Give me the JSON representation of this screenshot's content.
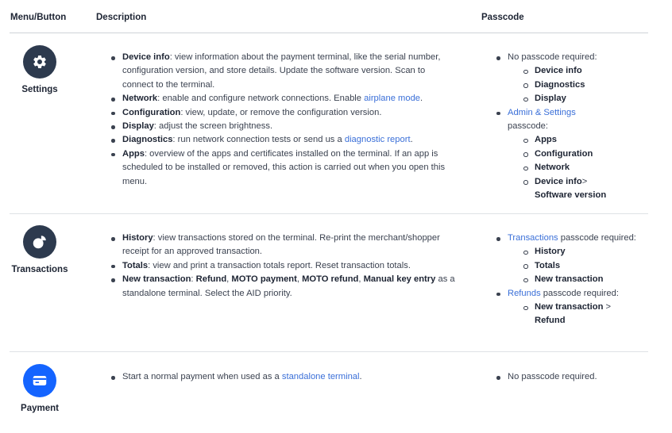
{
  "header": {
    "col1": "Menu/Button",
    "col2": "Description",
    "col3": "Passcode"
  },
  "colors": {
    "accent": "#3a6fd8",
    "icon_dark": "#2d3a4e",
    "payment_blue": "#1464ff"
  },
  "rows": {
    "settings": {
      "label": "Settings",
      "icon": "gear-icon",
      "desc": [
        {
          "term": "Device info",
          "text": ": view information about the payment terminal, like the serial number, configuration version, and store details. Update the software version. Scan to connect to the terminal."
        },
        {
          "term": "Network",
          "text": ": enable and configure network connections. Enable ",
          "link": "airplane mode",
          "after": "."
        },
        {
          "term": "Configuration",
          "text": ": view, update, or remove the configuration version."
        },
        {
          "term": "Display",
          "text": ": adjust the screen brightness."
        },
        {
          "term": "Diagnostics",
          "text": ": run network connection tests or send us a ",
          "link": "diagnostic report",
          "after": "."
        },
        {
          "term": "Apps",
          "text": ": overview of the apps and certificates installed on the terminal. If an app is scheduled to be installed or removed, this action is carried out when you open this menu."
        }
      ],
      "pass": {
        "p1": "No passcode required:",
        "p1_items": [
          "Device info",
          "Diagnostics",
          "Display"
        ],
        "p2_link": "Admin & Settings",
        "p2_text": "passcode:",
        "p2_items": [
          "Apps",
          "Configuration",
          "Network",
          "Device info"
        ],
        "p2_last_suffix": ">",
        "p2_last_line2": "Software version"
      }
    },
    "transactions": {
      "label": "Transactions",
      "icon": "transactions-icon",
      "desc": [
        {
          "term": "History",
          "text": ": view transactions stored on the terminal. Re-print the merchant/shopper receipt for an approved transaction."
        },
        {
          "term": "Totals",
          "text": ": view and print a transaction totals report. Reset transaction totals."
        },
        {
          "term": "New transaction",
          "sep1": ": ",
          "b1": "Refund",
          "sep2": ", ",
          "b2": "MOTO payment",
          "sep3": ", ",
          "b3": "MOTO refund",
          "sep4": ", ",
          "b4": "Manual key entry",
          "text": " as a standalone terminal. Select the AID priority."
        }
      ],
      "pass": {
        "p1_link": "Transactions",
        "p1_text": " passcode required:",
        "p1_items": [
          "History",
          "Totals",
          "New transaction"
        ],
        "p2_link": "Refunds",
        "p2_text": " passcode required:",
        "p2_item": "New transaction",
        "p2_item_suffix": " >",
        "p2_item_line2": "Refund"
      }
    },
    "payment": {
      "label": "Payment",
      "icon": "card-icon",
      "desc": {
        "text": "Start a normal payment when used as a ",
        "link": "standalone terminal",
        "after": "."
      },
      "pass": {
        "p1": "No passcode required."
      }
    }
  }
}
